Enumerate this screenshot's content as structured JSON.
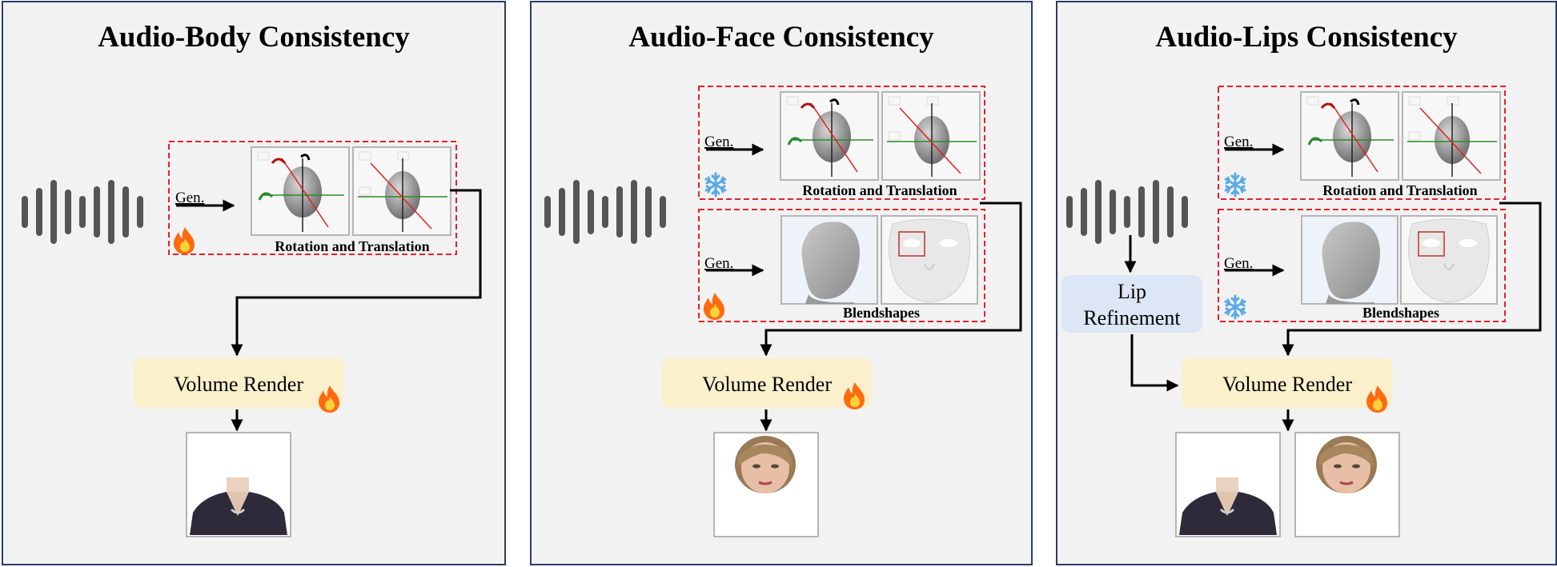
{
  "panels": [
    {
      "title": "Audio-Body Consistency"
    },
    {
      "title": "Audio-Face Consistency"
    },
    {
      "title": "Audio-Lips Consistency"
    }
  ],
  "labels": {
    "gen": "Gen.",
    "rotation_translation": "Rotation and Translation",
    "blendshapes": "Blendshapes",
    "volume_render": "Volume Render",
    "lip_refinement_line1": "Lip",
    "lip_refinement_line2": "Refinement"
  },
  "icons": {
    "trainable": "fire-icon",
    "frozen": "snowflake-icon"
  },
  "colors": {
    "panel_bg": "#f2f2f2",
    "panel_border": "#2c3e66",
    "dashed_box": "#e8202a",
    "render_box": "#fbf0cc",
    "lip_box": "#dce6f4",
    "waveform": "#555555",
    "fire": "#ff6a10",
    "snowflake": "#5aa9e6"
  }
}
